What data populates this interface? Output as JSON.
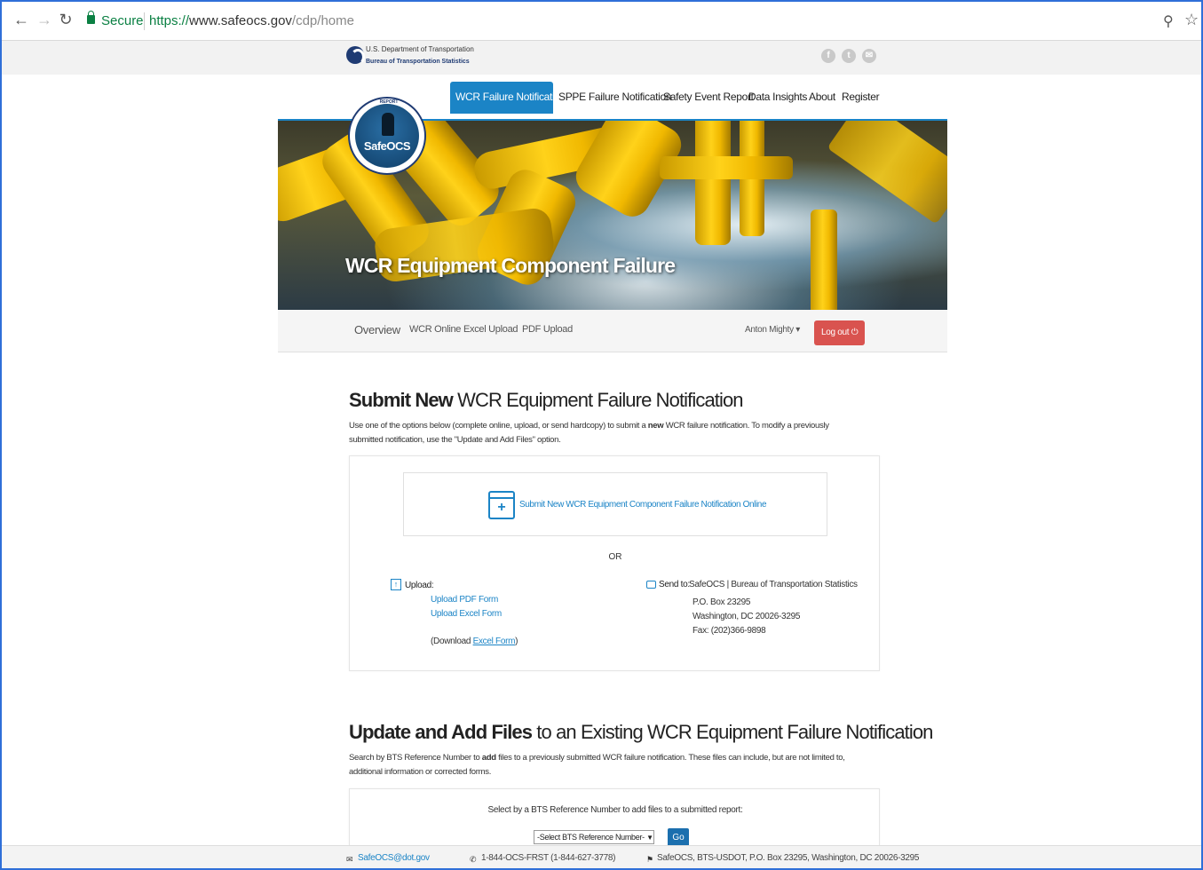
{
  "browser": {
    "secure_label": "Secure",
    "url_scheme": "https://",
    "url_host": "www.safeocs.gov",
    "url_path": "/cdp/home"
  },
  "header": {
    "agency_line1": "U.S. Department of Transportation",
    "agency_line2": "Bureau of Transportation Statistics",
    "social_icons": [
      "facebook-icon",
      "twitter-icon",
      "email-icon"
    ]
  },
  "main_nav": {
    "items": [
      {
        "label": "WCR Failure Notification",
        "active": true
      },
      {
        "label": "SPPE Failure Notification",
        "active": false
      },
      {
        "label": "Safety Event Report",
        "active": false
      },
      {
        "label": "Data Insights",
        "active": false
      },
      {
        "label": "About",
        "active": false
      },
      {
        "label": "Register",
        "active": false
      }
    ]
  },
  "hero": {
    "title": "WCR Equipment Component Failure",
    "badge_text": "SafeOCS",
    "badge_ring": "REPORT"
  },
  "sub_nav": {
    "items": [
      "Overview",
      "WCR Online",
      "Excel Upload",
      "PDF Upload"
    ],
    "user": "Anton Mighty",
    "logout": "Log out"
  },
  "submit_section": {
    "title_bold": "Submit New",
    "title_rest": " WCR Equipment Failure Notification",
    "desc_part1": "Use one of the options below (complete online, upload, or send hardcopy) to submit a ",
    "desc_bold": "new",
    "desc_part2": " WCR failure notification. To modify a previously submitted notification, use the \"Update and Add Files\" option.",
    "online_link": "Submit New WCR Equipment Component Failure Notification Online",
    "or_label": "OR",
    "upload_label": "Upload:",
    "upload_pdf": "Upload PDF Form",
    "upload_excel": "Upload Excel Form",
    "download_prefix": "(Download ",
    "download_link": "Excel Form",
    "download_suffix": ")",
    "send_to_label": "Send to:",
    "send_to_org": "SafeOCS | Bureau of Transportation Statistics",
    "address_line1": "P.O. Box 23295",
    "address_line2": "Washington, DC 20026-3295",
    "fax": "Fax: (202)366-9898"
  },
  "update_section": {
    "title_bold": "Update and Add Files",
    "title_rest": " to an Existing WCR Equipment Failure Notification",
    "desc_part1": "Search by BTS Reference Number to ",
    "desc_bold": "add",
    "desc_part2": " files to a previously submitted WCR failure notification. These files can include, but are not limited to, additional information or corrected forms.",
    "select_prompt": "Select by a BTS Reference Number to add files to a submitted report:",
    "select_value": "-Select BTS Reference Number-",
    "go_label": "Go"
  },
  "footer": {
    "email": "SafeOCS@dot.gov",
    "phone": "1-844-OCS-FRST (1-844-627-3778)",
    "address": "SafeOCS, BTS-USDOT, P.O. Box 23295, Washington, DC 20026-3295"
  }
}
